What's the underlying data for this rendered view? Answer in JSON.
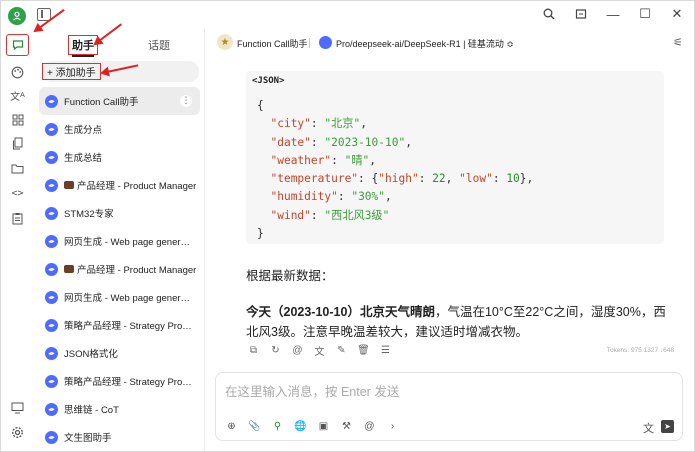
{
  "rail": {
    "icons": [
      "chat-icon",
      "palette-icon",
      "translate-icon",
      "apps-icon",
      "files-icon",
      "folder-icon",
      "code-icon",
      "clipboard-icon",
      "monitor-icon",
      "settings-icon"
    ]
  },
  "tabs": {
    "assistant": "助手",
    "topic": "话题"
  },
  "add_button": {
    "label": "+ 添加助手"
  },
  "assistants": [
    {
      "label": "Function Call助手",
      "selected": true
    },
    {
      "label": "生成分点"
    },
    {
      "label": "生成总结"
    },
    {
      "label": "产品经理 - Product Manager",
      "bag": true
    },
    {
      "label": "STM32专家"
    },
    {
      "label": "网页生成 - Web page generation"
    },
    {
      "label": "产品经理 - Product Manager",
      "bag": true
    },
    {
      "label": "网页生成 - Web page generation"
    },
    {
      "label": "策略产品经理 - Strategy Product..."
    },
    {
      "label": "JSON格式化"
    },
    {
      "label": "策略产品经理 - Strategy Product..."
    },
    {
      "label": "思维链 - CoT"
    },
    {
      "label": "文生图助手"
    }
  ],
  "chat_header": {
    "assistant": "Function Call助手",
    "model": "Pro/deepseek-ai/DeepSeek-R1 | 硅基流动 ≎"
  },
  "code": {
    "lang": "<JSON>"
  },
  "message": {
    "intro": "根据最新数据：",
    "bold": "今天（2023-10-10）北京天气晴朗",
    "rest": "，气温在10°C至22°C之间，湿度30%，西北风3级。注意早晚温差较大，建议适时增减衣物。"
  },
  "tokens": "Tokens: 975  1327  ↓648",
  "input": {
    "placeholder": "在这里输入消息，按 Enter 发送"
  }
}
